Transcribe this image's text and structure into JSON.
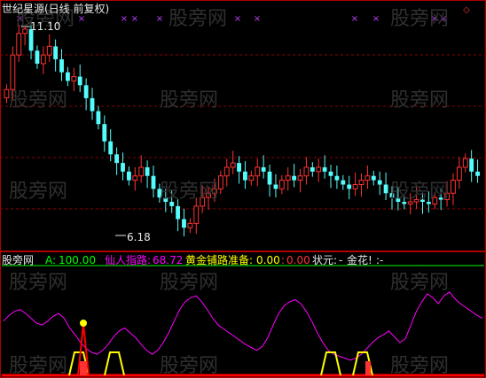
{
  "top_panel": {
    "title": "世纪星源(日线 前复权)",
    "high_marker": "11.10",
    "low_marker": "6.18",
    "watermark": "股旁网"
  },
  "indicator_bar": {
    "panel_name": "股旁网",
    "a_label": "A:",
    "a_value": "100.00",
    "xianren_label": "仙人指路:",
    "xianren_value": "68.72",
    "huangjin_label": "黄金铺路准备:",
    "huangjin_value": "0.00",
    "colon_sep": ":",
    "extra_value": "0.00",
    "status_label": "状元:",
    "status_value": "-",
    "jinhua_label": "金花!",
    "jinhua_value": ":-"
  },
  "colors": {
    "up": "#ff3232",
    "down": "#54fcfc",
    "grid": "#8b0000",
    "frame": "#b00000",
    "magenta": "#ff00ff",
    "yellow": "#ffff00",
    "green_line": "#00ff00",
    "markers": "#c040ff",
    "watermark": "#3a3a3a"
  },
  "chart_data": {
    "type": "candlestick",
    "price_high": 11.1,
    "price_low": 6.18,
    "indicator_range": [
      0,
      100
    ],
    "candles_close": [
      9.6,
      10.4,
      10.9,
      11.0,
      10.5,
      10.2,
      10.4,
      10.6,
      10.3,
      10.0,
      9.8,
      9.9,
      9.7,
      9.4,
      9.1,
      8.8,
      8.4,
      8.1,
      7.9,
      7.7,
      7.5,
      7.6,
      7.8,
      7.6,
      7.3,
      7.1,
      7.0,
      6.9,
      6.6,
      6.4,
      6.5,
      6.9,
      7.1,
      7.2,
      7.3,
      7.6,
      7.8,
      7.9,
      7.7,
      7.5,
      7.6,
      7.8,
      7.7,
      7.4,
      7.3,
      7.5,
      7.6,
      7.5,
      7.6,
      7.8,
      7.7,
      7.8,
      7.7,
      7.6,
      7.5,
      7.4,
      7.3,
      7.4,
      7.5,
      7.6,
      7.5,
      7.4,
      7.2,
      7.1,
      7.0,
      6.95,
      7.0,
      7.05,
      7.0,
      6.95,
      7.1,
      7.05,
      7.2,
      7.5,
      7.8,
      8.0,
      7.7,
      7.6
    ],
    "indicator_line": [
      52,
      58,
      62,
      64,
      60,
      55,
      50,
      48,
      52,
      57,
      60,
      55,
      45,
      38,
      30,
      24,
      20,
      18,
      22,
      28,
      36,
      42,
      45,
      40,
      35,
      28,
      22,
      18,
      22,
      30,
      40,
      52,
      64,
      72,
      76,
      78,
      72,
      64,
      55,
      48,
      44,
      40,
      36,
      32,
      28,
      25,
      22,
      26,
      35,
      48,
      60,
      68,
      72,
      74,
      70,
      62,
      52,
      40,
      30,
      22,
      18,
      16,
      14,
      12,
      14,
      18,
      24,
      30,
      35,
      38,
      42,
      36,
      30,
      34,
      48,
      62,
      72,
      80,
      76,
      70,
      78,
      82,
      75,
      70,
      66,
      62,
      58,
      55
    ]
  }
}
